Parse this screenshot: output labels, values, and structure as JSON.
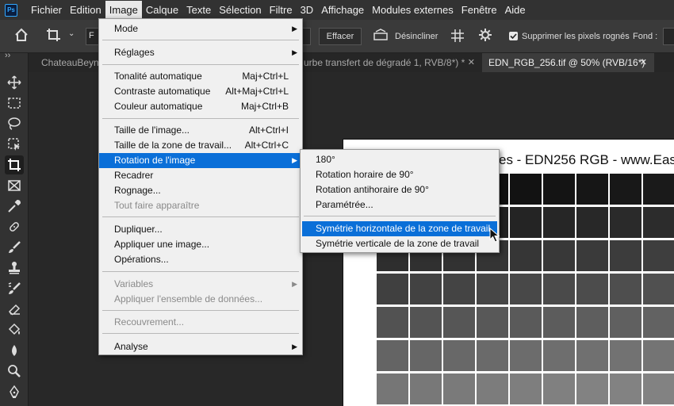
{
  "menubar": {
    "logo": "Ps",
    "items": [
      "Fichier",
      "Edition",
      "Image",
      "Calque",
      "Texte",
      "Sélection",
      "Filtre",
      "3D",
      "Affichage",
      "Modules externes",
      "Fenêtre",
      "Aide"
    ],
    "active": "Image"
  },
  "options": {
    "partial_left": "F",
    "effacer": "Effacer",
    "desincliner": "Désincliner",
    "supprimer_label": "Supprimer les pixels rognés",
    "supprimer_checked": true,
    "fond_label": "Fond :"
  },
  "tabs": {
    "tab1": "ChateauBeyne",
    "tab2": "urbe transfert de dégradé 1, RVB/8*) *",
    "tab2_close": "✕",
    "tab3": "EDN_RGB_256.tif @ 50% (RVB/16*)",
    "tab3_close": "✕"
  },
  "toolbar": {
    "collapse": "››",
    "tools": [
      "move-icon",
      "marquee-icon",
      "lasso-icon",
      "object-select-icon",
      "crop-icon",
      "frame-icon",
      "eyedropper-icon",
      "healing-icon",
      "brush-icon",
      "stamp-icon",
      "history-brush-icon",
      "eraser-icon",
      "paint-bucket-icon",
      "blur-icon",
      "dodge-icon",
      "pen-icon"
    ]
  },
  "document": {
    "title_partial": "es - EDN256 RGB - www.Easy"
  },
  "image_menu": {
    "mode": "Mode",
    "reglages": "Réglages",
    "tonalite": {
      "label": "Tonalité automatique",
      "shortcut": "Maj+Ctrl+L"
    },
    "contraste": {
      "label": "Contraste automatique",
      "shortcut": "Alt+Maj+Ctrl+L"
    },
    "couleur": {
      "label": "Couleur automatique",
      "shortcut": "Maj+Ctrl+B"
    },
    "taille_image": {
      "label": "Taille de l'image...",
      "shortcut": "Alt+Ctrl+I"
    },
    "taille_zone": {
      "label": "Taille de la zone de travail...",
      "shortcut": "Alt+Ctrl+C"
    },
    "rotation": "Rotation de l'image",
    "recadrer": "Recadrer",
    "rognage": "Rognage...",
    "tout_faire": "Tout faire apparaître",
    "dupliquer": "Dupliquer...",
    "appliquer_image": "Appliquer une image...",
    "operations": "Opérations...",
    "variables": "Variables",
    "appliquer_ensemble": "Appliquer l'ensemble de données...",
    "recouvrement": "Recouvrement...",
    "analyse": "Analyse"
  },
  "rotation_submenu": {
    "r180": "180°",
    "horaire": "Rotation horaire de 90°",
    "antihoraire": "Rotation antihoraire de 90°",
    "parametree": "Paramétrée...",
    "sym_horiz": "Symétrie horizontale de la zone de travail",
    "sym_vert": "Symétrie verticale de la zone de travail"
  }
}
